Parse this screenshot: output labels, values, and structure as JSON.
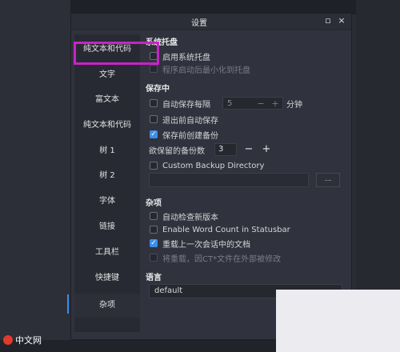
{
  "dialog": {
    "title": "设置",
    "restore_glyph": "▫",
    "close_glyph": "×"
  },
  "sidebar": {
    "items": [
      {
        "label": "纯文本和代码"
      },
      {
        "label": "文字"
      },
      {
        "label": "富文本"
      },
      {
        "label": "纯文本和代码"
      },
      {
        "label": "树 1"
      },
      {
        "label": "树 2"
      },
      {
        "label": "字体"
      },
      {
        "label": "链接"
      },
      {
        "label": "工具栏"
      },
      {
        "label": "快捷键"
      },
      {
        "label": "杂项"
      }
    ],
    "active_index": 10
  },
  "systray": {
    "title": "系统托盘",
    "enable_label": "启用系统托盘",
    "start_minimized_label": "程序启动后最小化到托盘"
  },
  "saving": {
    "title": "保存中",
    "autosave_label": "自动保存每隔",
    "autosave_value": "5",
    "autosave_unit": "分钟",
    "save_on_exit_label": "退出前自动保存",
    "backup_before_save_label": "保存前创建备份",
    "backup_count_label": "欲保留的备份数",
    "backup_count_value": "3",
    "minus_glyph": "−",
    "plus_glyph": "+",
    "custom_backup_label": "Custom Backup Directory",
    "browse_label": "..."
  },
  "misc": {
    "title": "杂项",
    "check_version_label": "自动检查新版本",
    "word_count_label": "Enable Word Count in Statusbar",
    "reopen_label": "重载上一次会话中的文档",
    "reload_modified_label": "将重载，因CT*文件在外部被修改"
  },
  "language": {
    "title": "语言",
    "selected": "default"
  },
  "watermark": {
    "text": "中文网"
  }
}
